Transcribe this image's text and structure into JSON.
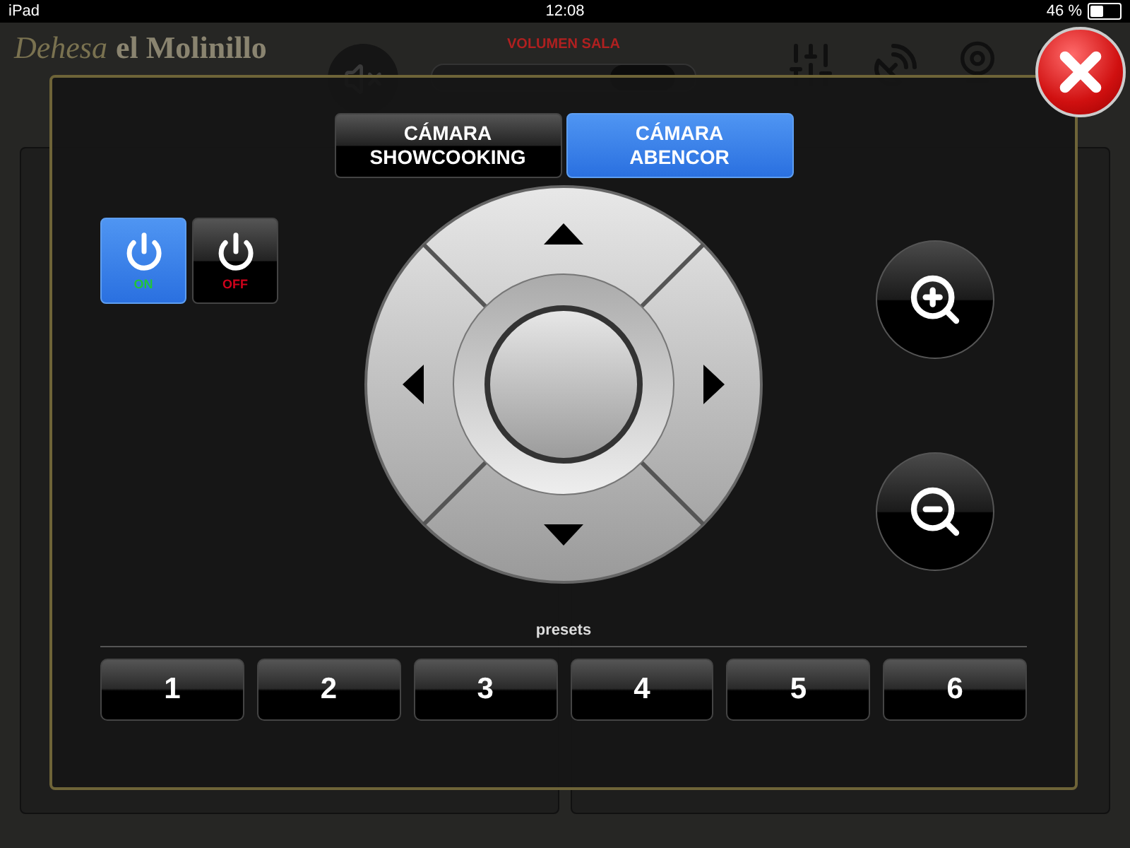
{
  "status_bar": {
    "device": "iPad",
    "time": "12:08",
    "battery": "46 %"
  },
  "header": {
    "logo_script": "Dehesa",
    "logo_name": "el Molinillo",
    "volume_label": "VOLUMEN SALA",
    "volume": {
      "level": 0.9
    }
  },
  "modal": {
    "tabs": [
      {
        "label": "CÁMARA\nSHOWCOOKING",
        "selected": false
      },
      {
        "label": "CÁMARA\nABENCOR",
        "selected": true
      }
    ],
    "power": [
      {
        "label": "ON",
        "selected": true,
        "color": "#22c33a"
      },
      {
        "label": "OFF",
        "selected": false,
        "color": "#d0021b"
      }
    ],
    "presets_label": "presets",
    "presets": [
      "1",
      "2",
      "3",
      "4",
      "5",
      "6"
    ]
  }
}
